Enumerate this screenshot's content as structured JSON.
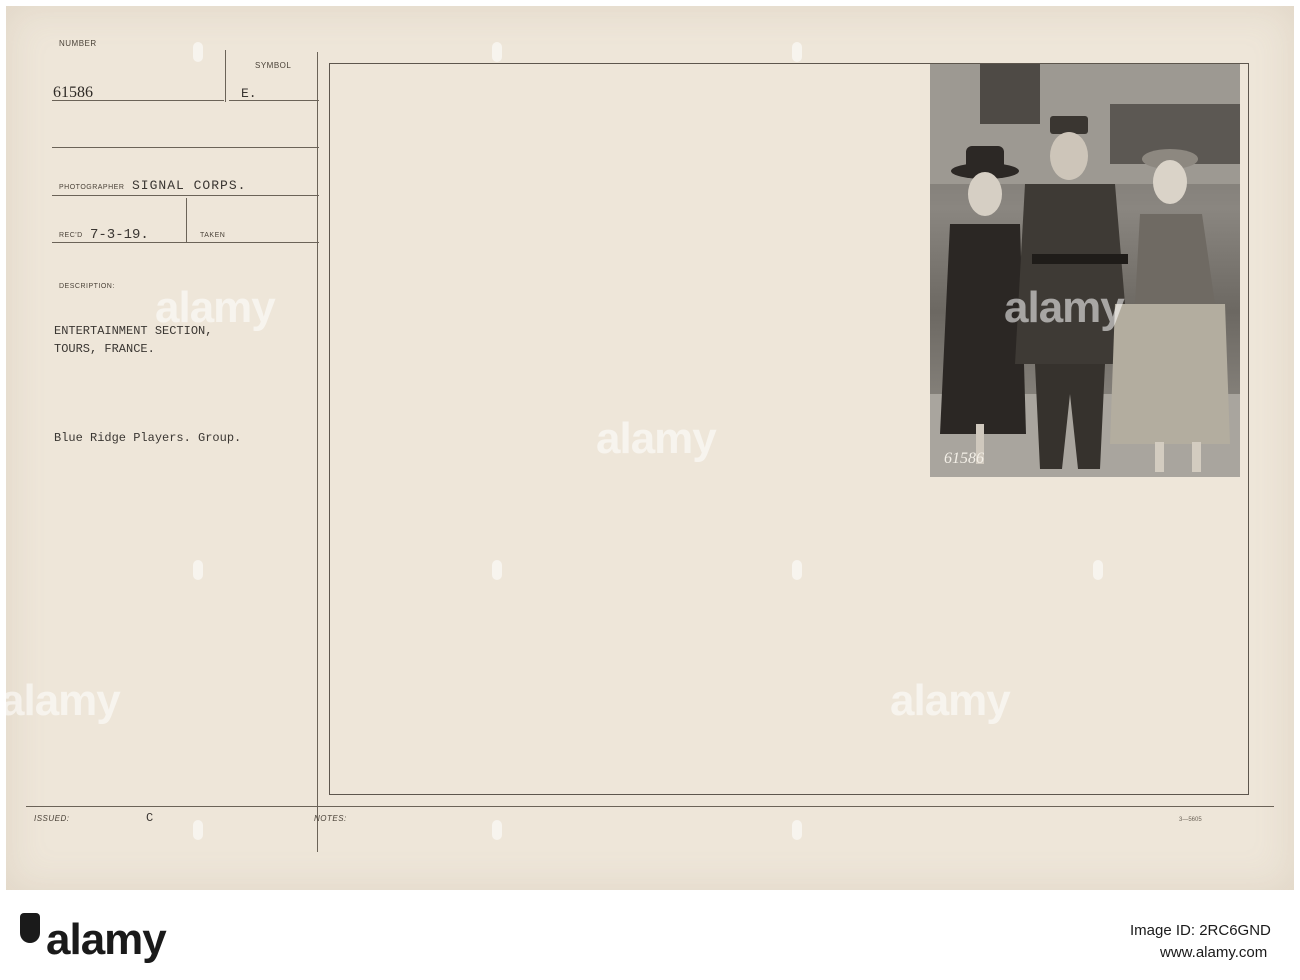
{
  "card": {
    "number_label": "NUMBER",
    "number_value": "61586",
    "symbol_label": "SYMBOL",
    "symbol_value": "E.",
    "photographer_label": "PHOTOGRAPHER",
    "photographer_value": "SIGNAL CORPS.",
    "recd_label": "REC'D",
    "recd_value": "7-3-19.",
    "taken_label": "TAKEN",
    "description_label": "DESCRIPTION:",
    "description_line1": "ENTERTAINMENT SECTION,",
    "description_line2": "TOURS, FRANCE.",
    "description_line3": "Blue Ridge Players. Group.",
    "issued_label": "ISSUED:",
    "issued_value": "C",
    "notes_label": "NOTES:",
    "page_code": "3—5605"
  },
  "photo": {
    "inscribed_number": "61586"
  },
  "watermark": {
    "text": "alamy"
  },
  "footer": {
    "brand": "alamy",
    "image_id_label": "Image ID: 2RC6GND",
    "site": "www.alamy.com"
  },
  "colors": {
    "card_paper": "#eee6d9",
    "ink": "#3a3632",
    "photo_tone": "#7a766f"
  }
}
